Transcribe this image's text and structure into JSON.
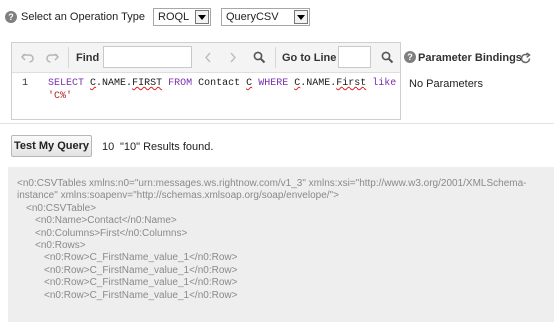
{
  "operation": {
    "label": "Select an Operation Type",
    "type_value": "ROQL",
    "mode_value": "QueryCSV"
  },
  "toolbar": {
    "find_label": "Find",
    "goto_label": "Go to Line"
  },
  "editor": {
    "line_number": "1",
    "code_tokens": {
      "select": "SELECT",
      "c1": "C",
      "name_first": ".NAME.",
      "first1": "FIRST",
      "from": "FROM",
      "contact": "Contact",
      "c2": "C",
      "where": "WHERE",
      "c3": "C",
      "name2": ".NAME.",
      "first2": "First",
      "like": "like",
      "pattern": "'C%'"
    }
  },
  "parameters": {
    "title": "Parameter Bindings",
    "empty_text": "No Parameters"
  },
  "query": {
    "button_label": "Test My Query",
    "count": "10",
    "result_text": "\"10\" Results found."
  },
  "results": {
    "xml_lines": [
      "<n0:CSVTables xmlns:n0=\"urn:messages.ws.rightnow.com/v1_3\" xmlns:xsi=\"http://www.w3.org/2001/XMLSchema-",
      "instance\" xmlns:soapenv=\"http://schemas.xmlsoap.org/soap/envelope/\">",
      "  <n0:CSVTable>",
      "    <n0:Name>Contact</n0:Name>",
      "    <n0:Columns>First</n0:Columns>",
      "    <n0:Rows>",
      "      <n0:Row>C_FirstName_value_1</n0:Row>",
      "      <n0:Row>C_FirstName_value_1</n0:Row>",
      "      <n0:Row>C_FirstName_value_1</n0:Row>",
      "      <n0:Row>C_FirstName_value_1</n0:Row>"
    ]
  }
}
